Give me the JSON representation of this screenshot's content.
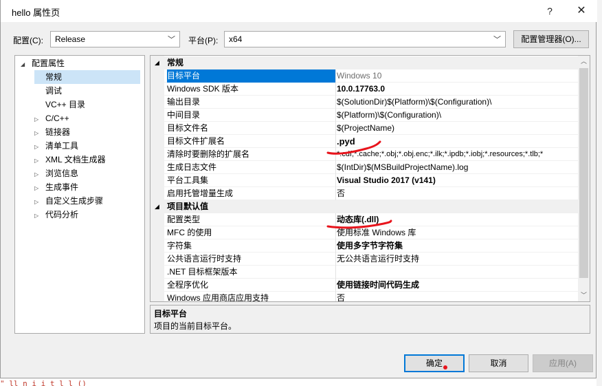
{
  "window": {
    "title": "hello 属性页",
    "help": "?",
    "close": "✕"
  },
  "toolbar": {
    "config_label": "配置(C):",
    "config_value": "Release",
    "platform_label": "平台(P):",
    "platform_value": "x64",
    "config_manager": "配置管理器(O)..."
  },
  "tree": {
    "root": "配置属性",
    "items": [
      {
        "label": "常规",
        "selected": true,
        "expandable": false
      },
      {
        "label": "调试",
        "expandable": false
      },
      {
        "label": "VC++ 目录",
        "expandable": false
      },
      {
        "label": "C/C++",
        "expandable": true
      },
      {
        "label": "链接器",
        "expandable": true
      },
      {
        "label": "清单工具",
        "expandable": true
      },
      {
        "label": "XML 文档生成器",
        "expandable": true
      },
      {
        "label": "浏览信息",
        "expandable": true
      },
      {
        "label": "生成事件",
        "expandable": true
      },
      {
        "label": "自定义生成步骤",
        "expandable": true
      },
      {
        "label": "代码分析",
        "expandable": true
      }
    ]
  },
  "grid": {
    "cat_general": "常规",
    "general": [
      {
        "name": "目标平台",
        "value": "Windows 10"
      },
      {
        "name": "Windows SDK 版本",
        "value": "10.0.17763.0"
      },
      {
        "name": "输出目录",
        "value": "$(SolutionDir)$(Platform)\\$(Configuration)\\"
      },
      {
        "name": "中间目录",
        "value": "$(Platform)\\$(Configuration)\\"
      },
      {
        "name": "目标文件名",
        "value": "$(ProjectName)"
      },
      {
        "name": "目标文件扩展名",
        "value": ".pyd"
      },
      {
        "name": "清除时要删除的扩展名",
        "value": "*.cdf;*.cache;*.obj;*.obj.enc;*.ilk;*.ipdb;*.iobj;*.resources;*.tlb;*"
      },
      {
        "name": "生成日志文件",
        "value": "$(IntDir)$(MSBuildProjectName).log"
      },
      {
        "name": "平台工具集",
        "value": "Visual Studio 2017 (v141)"
      },
      {
        "name": "启用托管增量生成",
        "value": "否"
      }
    ],
    "cat_defaults": "项目默认值",
    "defaults": [
      {
        "name": "配置类型",
        "value": "动态库(.dll)"
      },
      {
        "name": "MFC 的使用",
        "value": "使用标准 Windows 库"
      },
      {
        "name": "字符集",
        "value": "使用多字节字符集"
      },
      {
        "name": "公共语言运行时支持",
        "value": "无公共语言运行时支持"
      },
      {
        "name": ".NET 目标框架版本",
        "value": ""
      },
      {
        "name": "全程序优化",
        "value": "使用链接时间代码生成"
      },
      {
        "name": "Windows 应用商店应用支持",
        "value": "否"
      }
    ]
  },
  "description": {
    "title": "目标平台",
    "text": "项目的当前目标平台。"
  },
  "buttons": {
    "ok": "确定",
    "cancel": "取消",
    "apply": "应用(A)"
  },
  "background": {
    "code_snippet": "\"  ll    n i  i  t l  l   ()"
  },
  "colors": {
    "selection": "#0078d7",
    "tree_selection": "#cce4f7",
    "annotation": "#e8141c"
  }
}
